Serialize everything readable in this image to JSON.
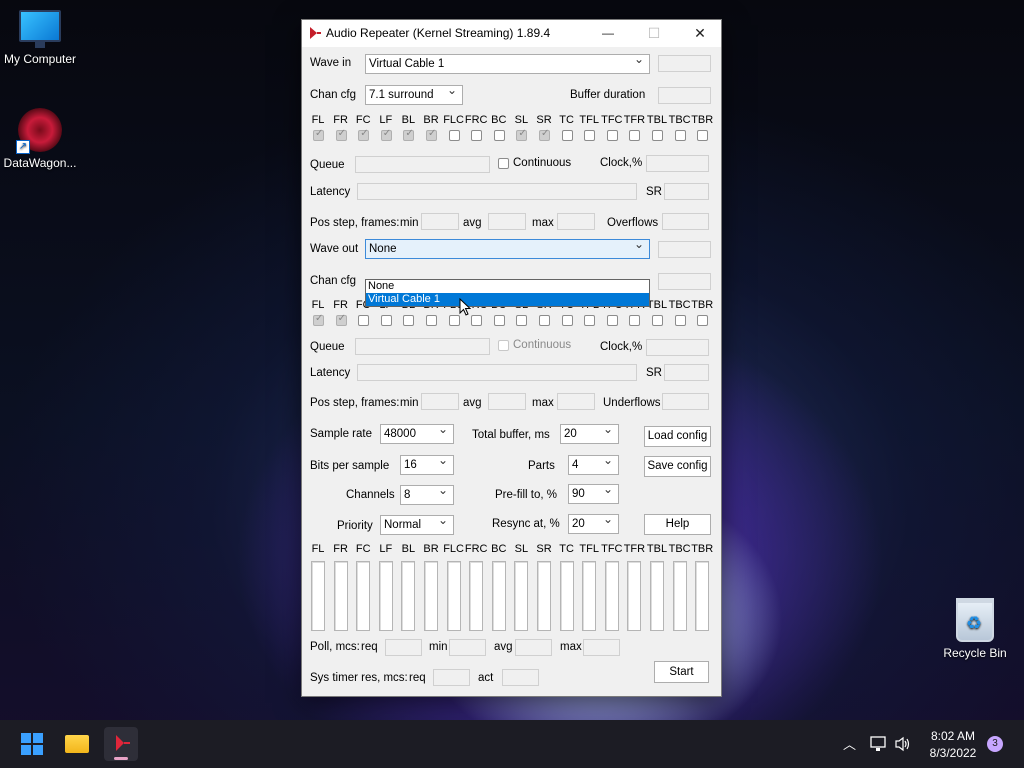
{
  "desktop": {
    "icons": [
      {
        "label": "My Computer"
      },
      {
        "label": "DataWagon..."
      },
      {
        "label": "Recycle Bin"
      }
    ]
  },
  "window": {
    "title": "Audio Repeater (Kernel Streaming) 1.89.4",
    "controls": {
      "minimize": "—",
      "maximize": "☐",
      "close": "✕"
    }
  },
  "wave_in": {
    "label": "Wave in",
    "device": "Virtual Cable 1",
    "chan_cfg_label": "Chan cfg",
    "chan_cfg": "7.1 surround",
    "buffer_duration_label": "Buffer duration",
    "queue_label": "Queue",
    "continuous_label": "Continuous",
    "clock_label": "Clock,%",
    "latency_label": "Latency",
    "sr_label": "SR",
    "pos_step_label": "Pos step, frames:",
    "min_label": "min",
    "avg_label": "avg",
    "max_label": "max",
    "overflows_label": "Overflows"
  },
  "wave_out": {
    "label": "Wave out",
    "device": "None",
    "dropdown_options": [
      "None",
      "Virtual Cable 1"
    ],
    "highlighted_option": "Virtual Cable 1",
    "chan_cfg_label": "Chan cfg",
    "queue_label": "Queue",
    "continuous_label": "Continuous",
    "clock_label": "Clock,%",
    "latency_label": "Latency",
    "sr_label": "SR",
    "pos_step_label": "Pos step, frames:",
    "min_label": "min",
    "avg_label": "avg",
    "max_label": "max",
    "underflows_label": "Underflows"
  },
  "channels": [
    "FL",
    "FR",
    "FC",
    "LF",
    "BL",
    "BR",
    "FLC",
    "FRC",
    "BC",
    "SL",
    "SR",
    "TC",
    "TFL",
    "TFC",
    "TFR",
    "TBL",
    "TBC",
    "TBR"
  ],
  "settings": {
    "sample_rate_label": "Sample rate",
    "sample_rate": "48000",
    "total_buffer_label": "Total buffer, ms",
    "total_buffer": "20",
    "bits_label": "Bits per sample",
    "bits": "16",
    "parts_label": "Parts",
    "parts": "4",
    "channels_label": "Channels",
    "channels": "8",
    "prefill_label": "Pre-fill to, %",
    "prefill": "90",
    "priority_label": "Priority",
    "priority": "Normal",
    "resync_label": "Resync at, %",
    "resync": "20"
  },
  "buttons": {
    "load_config": "Load config",
    "save_config": "Save config",
    "help": "Help",
    "start": "Start"
  },
  "poll": {
    "label": "Poll, mcs:",
    "req": "req",
    "min": "min",
    "avg": "avg",
    "max": "max"
  },
  "sys_timer": {
    "label": "Sys timer res, mcs:",
    "req": "req",
    "act": "act"
  },
  "taskbar": {
    "time": "8:02 AM",
    "date": "8/3/2022",
    "notifications": "3"
  }
}
